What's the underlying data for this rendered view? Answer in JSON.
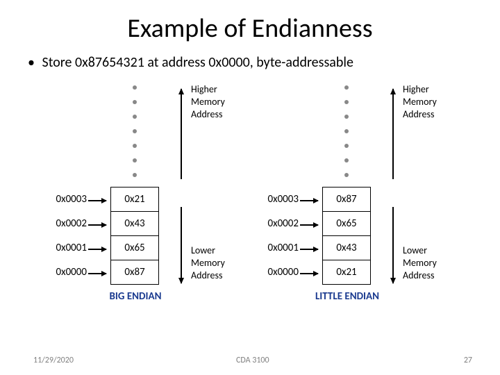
{
  "title": "Example of Endianness",
  "bullet": "Store 0x87654321 at address 0x0000, byte-addressable",
  "addresses": [
    "0x0003",
    "0x0002",
    "0x0001",
    "0x0000"
  ],
  "big_endian": {
    "bytes_top_to_bottom": [
      "0x21",
      "0x43",
      "0x65",
      "0x87"
    ],
    "caption": "BIG ENDIAN"
  },
  "little_endian": {
    "bytes_top_to_bottom": [
      "0x87",
      "0x65",
      "0x43",
      "0x21"
    ],
    "caption": "LITTLE ENDIAN"
  },
  "labels": {
    "higher": "Higher\nMemory\nAddress",
    "lower": "Lower\nMemory\nAddress"
  },
  "footer": {
    "date": "11/29/2020",
    "course": "CDA 3100",
    "page": "27"
  }
}
